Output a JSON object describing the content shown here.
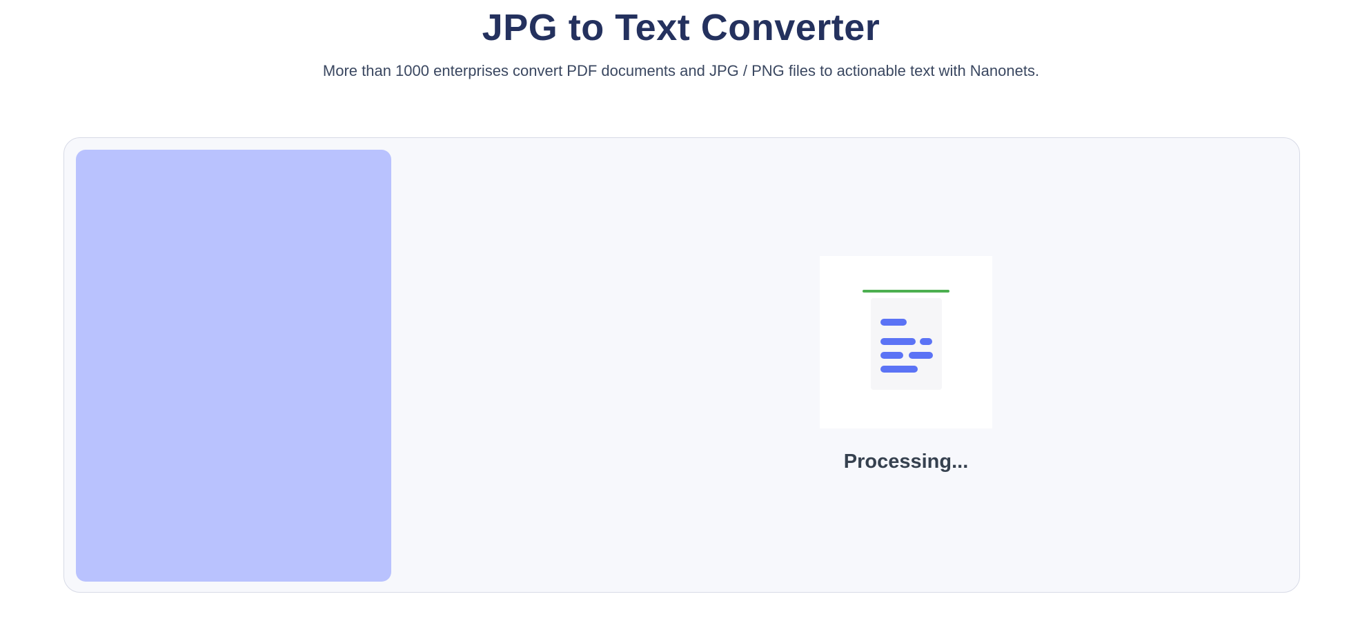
{
  "header": {
    "title": "JPG to Text Converter",
    "subtitle": "More than 1000 enterprises convert PDF documents and JPG / PNG files to actionable text with Nanonets."
  },
  "converter": {
    "status": "Processing...",
    "loader_icon": "document-scan-icon"
  },
  "colors": {
    "title": "#24315e",
    "card_background": "#f7f8fc",
    "preview_placeholder": "#b9c2fe",
    "scan_line": "#4caf50",
    "document_lines": "#5b73f5"
  }
}
